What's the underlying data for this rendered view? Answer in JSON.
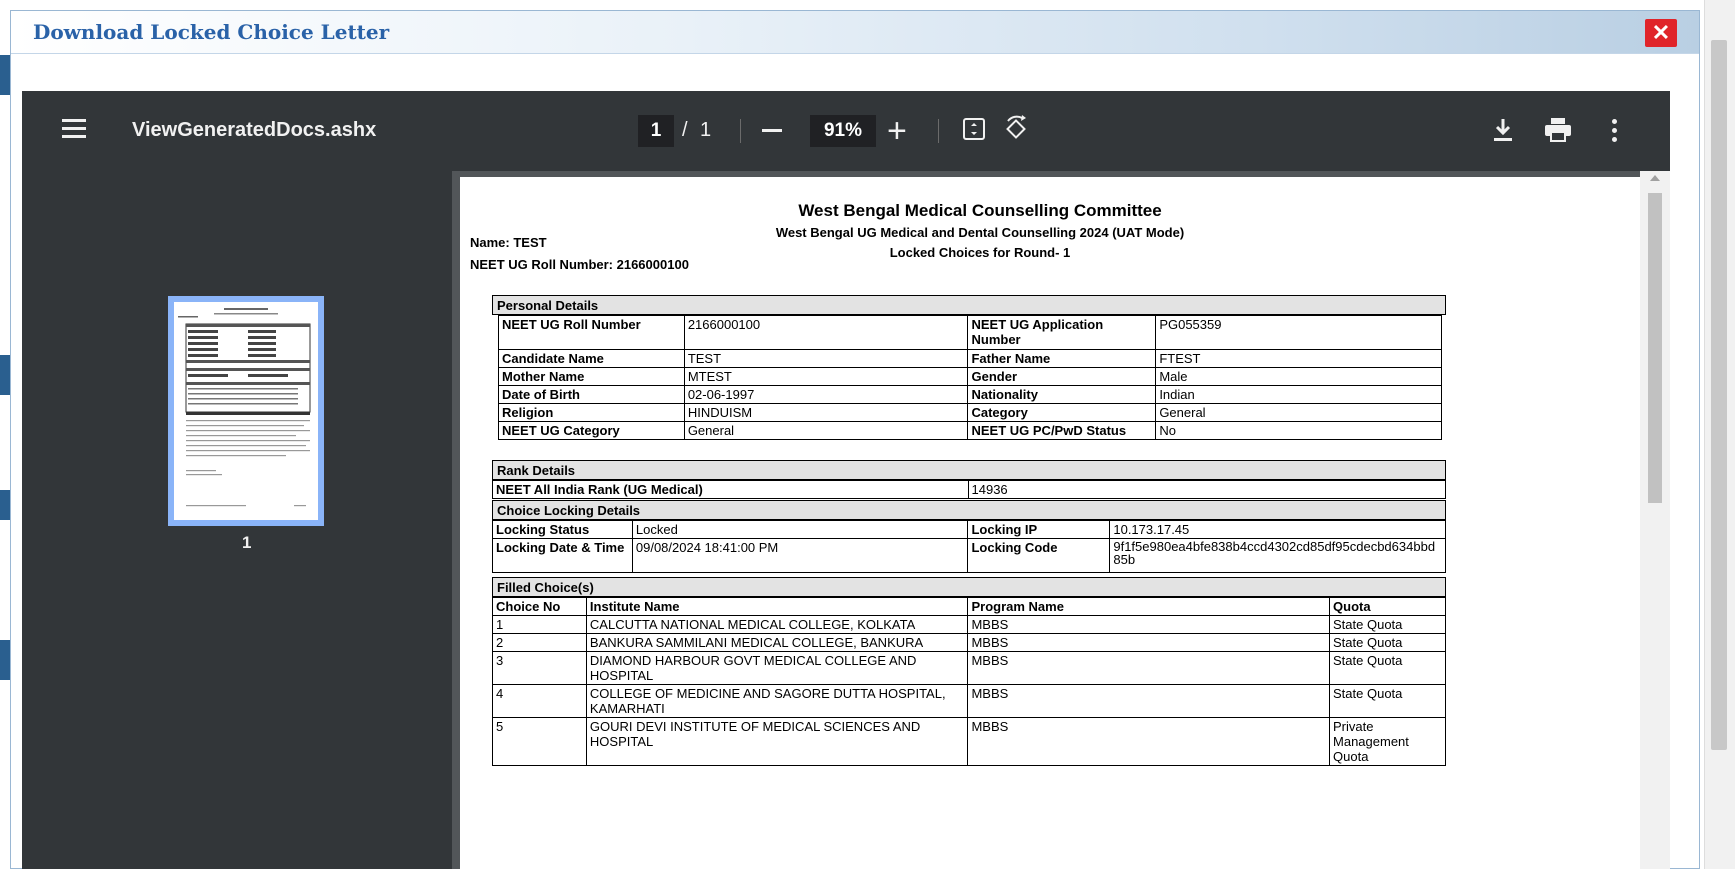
{
  "modal": {
    "title": "Download Locked Choice Letter",
    "close_label": "✕"
  },
  "viewer": {
    "filename": "ViewGeneratedDocs.ashx",
    "current_page": "1",
    "page_sep": "/",
    "total_pages": "1",
    "zoom": "91%",
    "thumbnail_label": "1",
    "icons": [
      "menu-icon",
      "zoom-out-icon",
      "zoom-in-icon",
      "fit-page-icon",
      "rotate-icon",
      "download-icon",
      "print-icon",
      "more-icon"
    ]
  },
  "doc": {
    "title": "West Bengal Medical Counselling Committee",
    "subtitle": "West Bengal UG Medical and Dental Counselling 2024 (UAT Mode)",
    "round": "Locked Choices for Round- 1",
    "name_line": "Name: TEST",
    "roll_line": "NEET UG Roll Number: 2166000100",
    "personal": {
      "header": "Personal Details",
      "rows": [
        [
          "NEET UG Roll Number",
          "2166000100",
          "NEET UG  Application Number",
          "PG055359"
        ],
        [
          "Candidate Name",
          "TEST",
          "Father Name",
          "FTEST"
        ],
        [
          "Mother Name",
          "MTEST",
          "Gender",
          "Male"
        ],
        [
          "Date of Birth",
          "02-06-1997",
          "Nationality",
          "Indian"
        ],
        [
          "Religion",
          "HINDUISM",
          "Category",
          "General"
        ],
        [
          "NEET UG Category",
          "General",
          "NEET UG PC/PwD Status",
          "No"
        ]
      ]
    },
    "rank": {
      "header": "Rank Details",
      "label": "NEET All India Rank (UG Medical)",
      "value": "14936"
    },
    "locking": {
      "header": "Choice Locking Details",
      "status_label": "Locking Status",
      "status_value": "Locked",
      "ip_label": "Locking IP",
      "ip_value": "10.173.17.45",
      "datetime_label": "Locking Date & Time",
      "datetime_value": "09/08/2024 18:41:00  PM",
      "code_label": "Locking Code",
      "code_value": "9f1f5e980ea4bfe838b4ccd4302cd85df95cdecbd634bbd85b"
    },
    "choices": {
      "header": "Filled Choice(s)",
      "columns": [
        "Choice No",
        "Institute Name",
        "Program Name",
        "Quota"
      ],
      "rows": [
        [
          "1",
          "CALCUTTA NATIONAL MEDICAL COLLEGE, KOLKATA",
          "MBBS",
          "State Quota"
        ],
        [
          "2",
          "BANKURA SAMMILANI MEDICAL COLLEGE, BANKURA",
          "MBBS",
          "State Quota"
        ],
        [
          "3",
          "DIAMOND HARBOUR GOVT MEDICAL COLLEGE AND HOSPITAL",
          "MBBS",
          "State Quota"
        ],
        [
          "4",
          "COLLEGE OF MEDICINE AND SAGORE DUTTA HOSPITAL, KAMARHATI",
          "MBBS",
          "State Quota"
        ],
        [
          "5",
          "GOURI DEVI INSTITUTE OF MEDICAL SCIENCES AND HOSPITAL",
          "MBBS",
          "Private Management Quota"
        ]
      ]
    }
  }
}
